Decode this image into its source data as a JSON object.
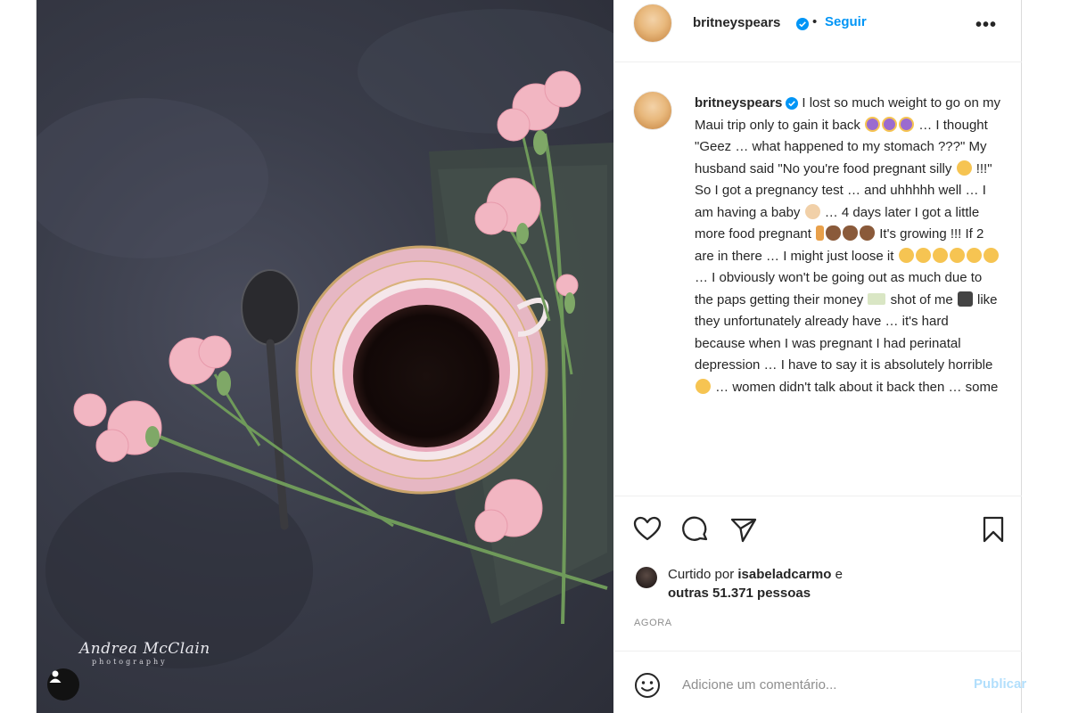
{
  "photo": {
    "watermark_name": "Andrea McClain",
    "watermark_sub": "photography",
    "user_tag_icon": "person-icon"
  },
  "header": {
    "username": "britneyspears",
    "verified_icon": "verified-badge-icon",
    "separator": "•",
    "follow_label": "Seguir",
    "more_label": "•••"
  },
  "caption": {
    "username": "britneyspears",
    "segments": [
      {
        "t": "text",
        "v": "I lost so much weight to go on my Maui trip only to gain it back "
      },
      {
        "t": "emoji",
        "c": "purple",
        "n": "woman-gesturing-no-emoji"
      },
      {
        "t": "emoji",
        "c": "purple",
        "n": "woman-gesturing-no-emoji"
      },
      {
        "t": "emoji",
        "c": "purple",
        "n": "woman-gesturing-no-emoji"
      },
      {
        "t": "text",
        "v": " … I thought \"Geez … what happened to my stomach ???\" My husband said \"No you're food pregnant silly "
      },
      {
        "t": "emoji",
        "c": "grin",
        "n": "grinning-face-emoji"
      },
      {
        "t": "text",
        "v": " !!!\" So I got a pregnancy test … and uhhhhh well … I am having a baby "
      },
      {
        "t": "emoji",
        "c": "baby",
        "n": "baby-emoji"
      },
      {
        "t": "text",
        "v": " … 4 days later I got a little more food pregnant "
      },
      {
        "t": "emoji",
        "c": "bottle",
        "n": "baby-bottle-emoji"
      },
      {
        "t": "emoji",
        "c": "monkey",
        "n": "see-no-evil-monkey-emoji"
      },
      {
        "t": "emoji",
        "c": "monkey",
        "n": "see-no-evil-monkey-emoji"
      },
      {
        "t": "emoji",
        "c": "monkey",
        "n": "see-no-evil-monkey-emoji"
      },
      {
        "t": "text",
        "v": " It's growing !!! If 2 are in there … I might just loose it "
      },
      {
        "t": "emoji",
        "c": "grin",
        "n": "grimacing-face-emoji"
      },
      {
        "t": "emoji",
        "c": "grin",
        "n": "grimacing-face-emoji"
      },
      {
        "t": "emoji",
        "c": "grin",
        "n": "grimacing-face-emoji"
      },
      {
        "t": "emoji",
        "c": "grin",
        "n": "grimacing-face-emoji"
      },
      {
        "t": "emoji",
        "c": "grin",
        "n": "grimacing-face-emoji"
      },
      {
        "t": "emoji",
        "c": "grin",
        "n": "grimacing-face-emoji"
      },
      {
        "t": "text",
        "v": " … I obviously won't be going out as much due to the paps getting their money "
      },
      {
        "t": "emoji",
        "c": "money",
        "n": "money-emoji"
      },
      {
        "t": "text",
        "v": " shot of me "
      },
      {
        "t": "emoji",
        "c": "cam",
        "n": "camera-emoji"
      },
      {
        "t": "text",
        "v": " like they unfortunately already have … it's hard because when I was pregnant I had perinatal depression … I have to say it is absolutely horrible "
      },
      {
        "t": "emoji",
        "c": "sad",
        "n": "disappointed-face-emoji"
      },
      {
        "t": "text",
        "v": " … women didn't talk about it back then … some"
      }
    ]
  },
  "actions": {
    "like_icon": "heart-icon",
    "comment_icon": "comment-bubble-icon",
    "share_icon": "paper-plane-icon",
    "save_icon": "bookmark-icon"
  },
  "likes": {
    "prefix": "Curtido por ",
    "liker": "isabeladcarmo",
    "suffix": " e",
    "others": "outras 51.371 pessoas"
  },
  "timestamp": "AGORA",
  "comment": {
    "emoji_icon": "smiley-icon",
    "placeholder": "Adicione um comentário...",
    "publish_label": "Publicar"
  },
  "colors": {
    "link_blue": "#0095f6",
    "publish_disabled": "#b2dffc",
    "muted": "#8e8e8e"
  }
}
